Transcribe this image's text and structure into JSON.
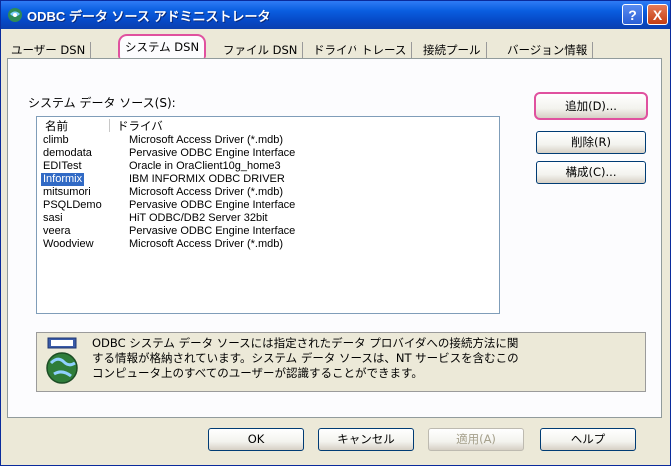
{
  "window": {
    "title": "ODBC データ ソース アドミニストレータ",
    "help_label": "?",
    "close_label": "X"
  },
  "tabs": [
    {
      "label": "ユーザー DSN"
    },
    {
      "label": "システム DSN"
    },
    {
      "label": "ファイル DSN"
    },
    {
      "label": "ドライバ"
    },
    {
      "label": "トレース"
    },
    {
      "label": "接続プール"
    },
    {
      "label": "バージョン情報"
    }
  ],
  "section_label": "システム データ ソース(S):",
  "list": {
    "headers": {
      "name": "名前",
      "driver": "ドライバ"
    },
    "rows": [
      {
        "name": "climb",
        "driver": "Microsoft Access Driver (*.mdb)"
      },
      {
        "name": "demodata",
        "driver": "Pervasive ODBC Engine Interface"
      },
      {
        "name": "EDITest",
        "driver": "Oracle in OraClient10g_home3"
      },
      {
        "name": "Informix",
        "driver": "IBM INFORMIX ODBC DRIVER"
      },
      {
        "name": "mitsumori",
        "driver": "Microsoft Access Driver (*.mdb)"
      },
      {
        "name": "PSQLDemo",
        "driver": "Pervasive ODBC Engine Interface"
      },
      {
        "name": "sasi",
        "driver": "HiT ODBC/DB2 Server 32bit"
      },
      {
        "name": "veera",
        "driver": "Pervasive ODBC Engine Interface"
      },
      {
        "name": "Woodview",
        "driver": "Microsoft Access Driver (*.mdb)"
      }
    ],
    "selected": "Informix"
  },
  "side_buttons": {
    "add": "追加(D)...",
    "remove": "削除(R)",
    "configure": "構成(C)..."
  },
  "info": {
    "line1": "ODBC システム データ ソースには指定されたデータ プロバイダへの接続方法に関",
    "line2": "する情報が格納されています。システム データ ソースは、NT サービスを含むこの",
    "line3": "コンピュータ上のすべてのユーザーが認識することができます。"
  },
  "bottom_buttons": {
    "ok": "OK",
    "cancel": "キャンセル",
    "apply": "適用(A)",
    "help": "ヘルプ"
  }
}
